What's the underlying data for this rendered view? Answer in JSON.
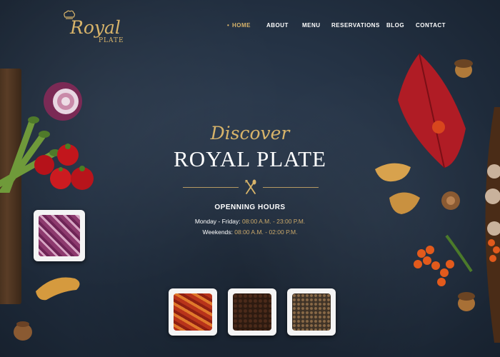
{
  "logo": {
    "script": "Royal",
    "small": "PLATE"
  },
  "nav": {
    "items": [
      {
        "label": "HOME",
        "active": true
      },
      {
        "label": "ABOUT",
        "active": false
      },
      {
        "label": "MENU",
        "active": false
      },
      {
        "label": "RESERVATIONS",
        "active": false
      },
      {
        "label": "BLOG",
        "active": false
      },
      {
        "label": "CONTACT",
        "active": false
      }
    ]
  },
  "hero": {
    "discover": "Discover",
    "title": "ROYAL PLATE",
    "hours_title": "OPENNING HOURS",
    "weekday_label": "Monday - Friday:",
    "weekday_value": "08:00 A.M. - 23:00 P.M.",
    "weekend_label": "Weekends:",
    "weekend_value": "08:00 A.M. - 02:00 P.M."
  },
  "colors": {
    "accent": "#d8b46a",
    "background": "#243244",
    "text": "#ffffff"
  },
  "icons": {
    "chef_hat": "chef-hat-icon",
    "cutlery": "cutlery-icon"
  }
}
